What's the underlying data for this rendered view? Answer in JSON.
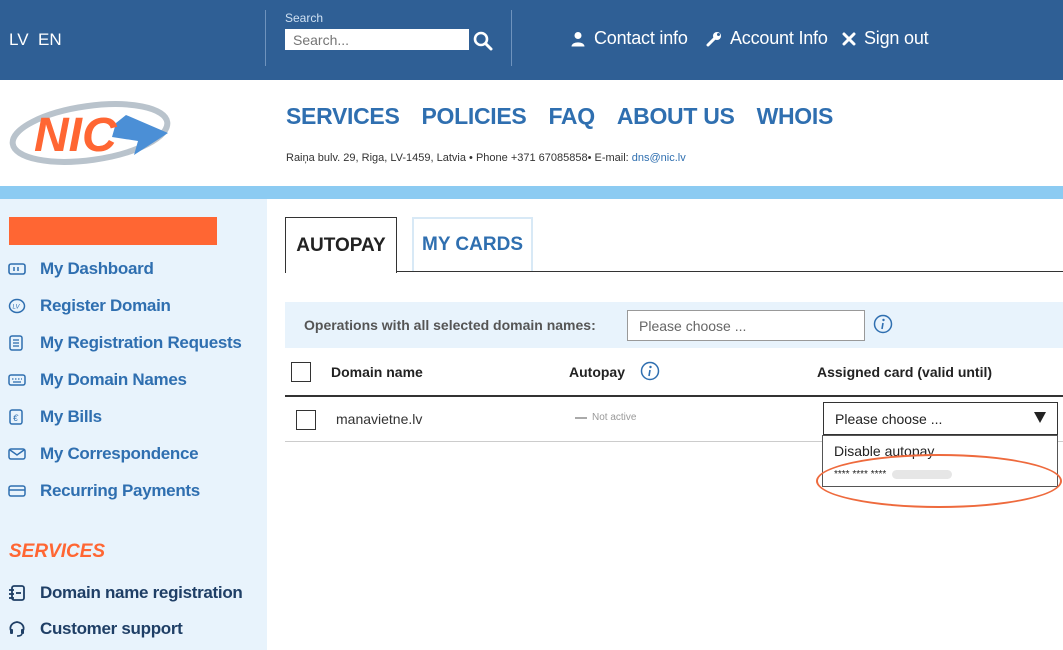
{
  "colors": {
    "topbar": "#2f5f95",
    "accent_orange": "#ff6633",
    "link_blue": "#2f6fb0",
    "sidebar_bg": "#e8f3fc",
    "highlight": "#ee6a3d"
  },
  "topbar": {
    "lang_lv": "LV",
    "lang_en": "EN",
    "search_label": "Search",
    "search_placeholder": "Search...",
    "contact": "Contact info",
    "account": "Account Info",
    "signout": "Sign out"
  },
  "header": {
    "logo_text": "NIC",
    "nav": [
      "SERVICES",
      "POLICIES",
      "FAQ",
      "ABOUT US",
      "WHOIS"
    ],
    "address": "Raiņa bulv. 29, Riga, LV-1459, Latvia • Phone +371 67085858• E-mail: ",
    "email": "dns@nic.lv"
  },
  "sidebar": {
    "items": [
      {
        "label": "My Dashboard",
        "icon": "dashboard-icon"
      },
      {
        "label": "Register Domain",
        "icon": "lv-domain-icon"
      },
      {
        "label": "My Registration Requests",
        "icon": "requests-icon"
      },
      {
        "label": "My Domain Names",
        "icon": "keyboard-icon"
      },
      {
        "label": "My Bills",
        "icon": "euro-icon"
      },
      {
        "label": "My Correspondence",
        "icon": "envelope-icon"
      },
      {
        "label": "Recurring Payments",
        "icon": "card-icon"
      }
    ],
    "services_heading": "SERVICES",
    "services": [
      {
        "label": "Domain name registration",
        "icon": "registration-icon"
      },
      {
        "label": "Customer support",
        "icon": "support-icon"
      }
    ]
  },
  "tabs": {
    "autopay": "AUTOPAY",
    "my_cards": "MY CARDS"
  },
  "operations": {
    "label": "Operations with all selected domain names:",
    "select_value": "Please choose ..."
  },
  "table": {
    "headers": {
      "domain": "Domain name",
      "autopay": "Autopay",
      "card": "Assigned card (valid until)"
    },
    "rows": [
      {
        "domain": "manavietne.lv",
        "autopay": "Not active",
        "card_select": "Please choose ..."
      }
    ]
  },
  "dropdown": {
    "options": [
      "Disable autopay",
      "**** **** ****"
    ]
  }
}
